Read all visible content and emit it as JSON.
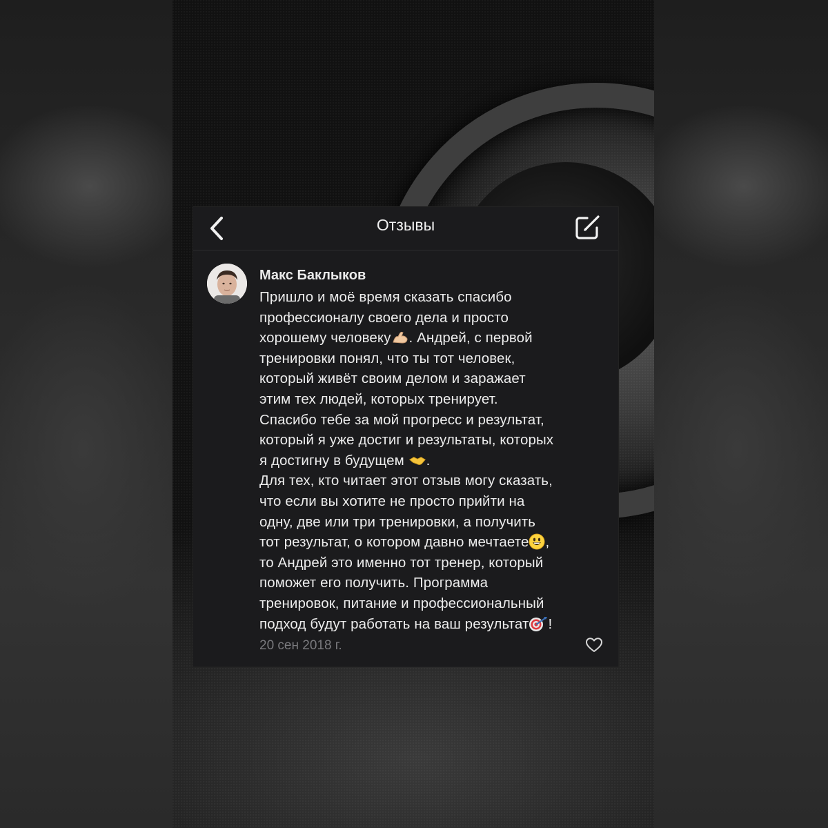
{
  "nav": {
    "title": "Отзывы",
    "back_icon": "chevron-left-icon",
    "compose_icon": "compose-icon"
  },
  "review": {
    "author": "Макс Баклыков",
    "paragraphs": {
      "p1_a": "Пришло и моё время сказать спасибо\nпрофессионалу своего дела и просто\nхорошему человеку",
      "p1_b": ". Андрей, с первой\nтренировки понял, что ты тот человек,\nкоторый живёт своим делом и заражает\nэтим тех людей, которых тренирует.\nСпасибо тебе за мой прогресс и результат,\nкоторый я уже достиг и результаты, которых\nя достигну в будущем ",
      "p1_c": ".\nДля тех, кто читает этот отзыв могу сказать,\nчто если вы хотите не просто прийти на\nодну, две или три тренировки, а получить\nтот результат, о котором давно мечтаете",
      "p1_d": ",\nто Андрей это именно тот тренер, который\nпоможет его получить. Программа\nтренировок, питание и профессиональный\nподход будут работать на ваш результат",
      "p1_e": "!"
    },
    "emojis": [
      "flexed-biceps-emoji",
      "handshake-emoji",
      "smiley-emoji",
      "direct-hit-emoji"
    ],
    "date": "20 сен 2018 г.",
    "like_icon": "heart-icon"
  },
  "colors": {
    "card_bg": "#1b1b1d",
    "text": "#ececec",
    "muted": "#7a7a7e"
  }
}
